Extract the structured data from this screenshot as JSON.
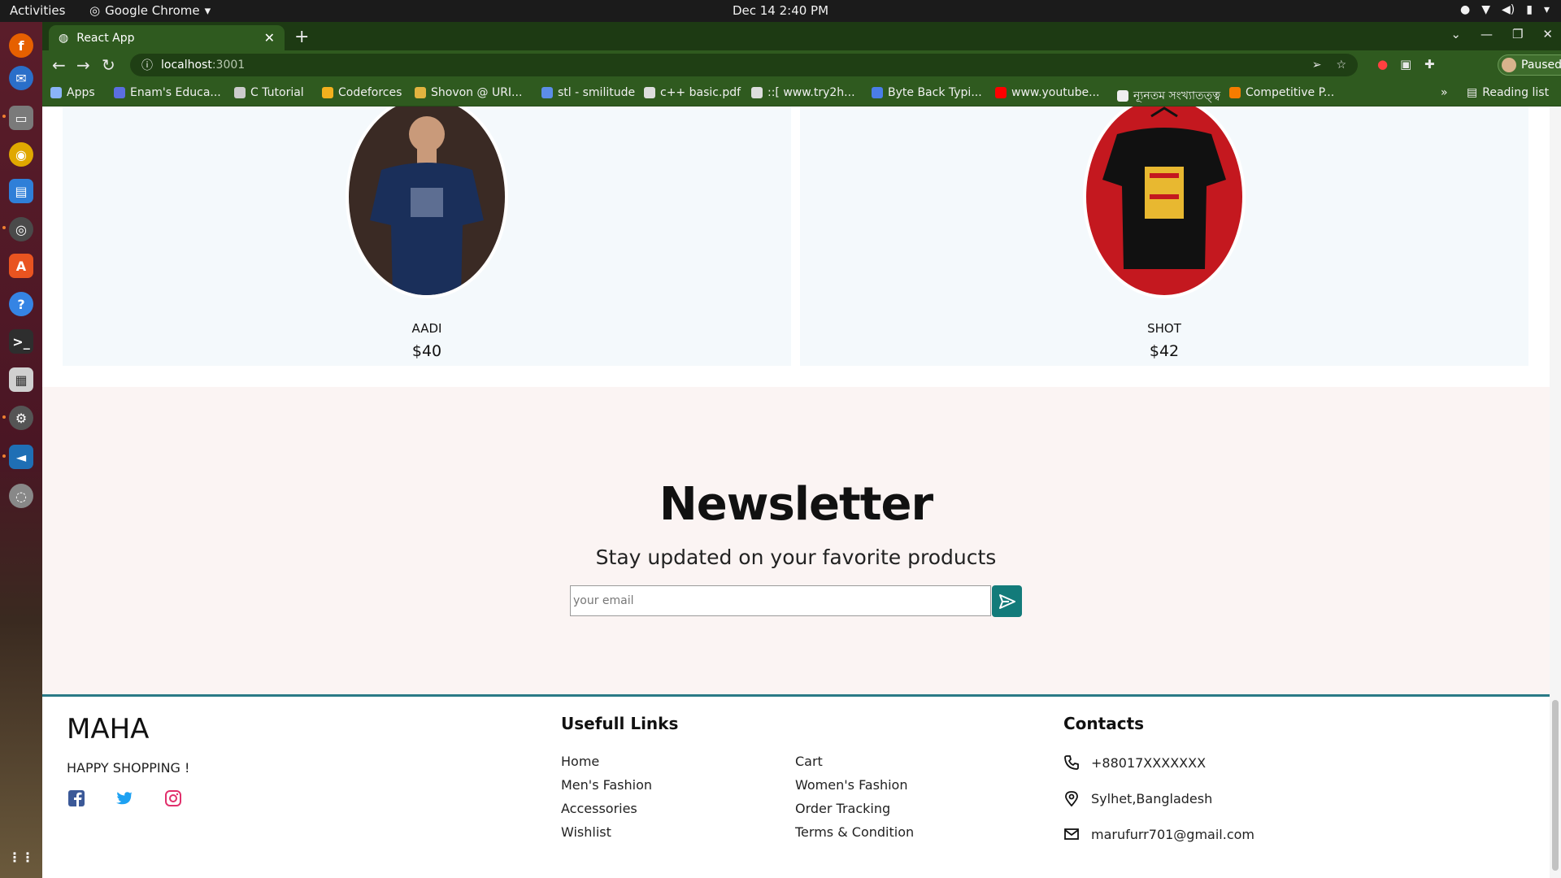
{
  "system": {
    "activities": "Activities",
    "app_name": "Google Chrome",
    "clock": "Dec 14  2:40 PM"
  },
  "browser": {
    "tab_title": "React App",
    "url_host": "localhost",
    "url_port": ":3001",
    "profile_label": "Paused",
    "bookmarks": [
      {
        "label": "Apps",
        "color": "#8ab4f8"
      },
      {
        "label": "Enam's Educa...",
        "color": "#5b6ee1"
      },
      {
        "label": "C Tutorial",
        "color": "#cccccc"
      },
      {
        "label": "Codeforces",
        "color": "#f2b01e"
      },
      {
        "label": "Shovon @ URI...",
        "color": "#e2b340"
      },
      {
        "label": "stl - smilitude",
        "color": "#5c8de8"
      },
      {
        "label": "c++ basic.pdf",
        "color": "#dddddd"
      },
      {
        "label": "::[ www.try2h...",
        "color": "#dddddd"
      },
      {
        "label": "Byte Back Typi...",
        "color": "#4a7de8"
      },
      {
        "label": "www.youtube...",
        "color": "#ff0000"
      },
      {
        "label": "ন্যূনতম সংখ্যাতত্ত্ব",
        "color": "#eeeeee"
      },
      {
        "label": "Competitive P...",
        "color": "#f57c00"
      }
    ],
    "reading_list": "Reading list"
  },
  "products": [
    {
      "name": "AADI",
      "price": "$40",
      "image_bg": "#3a2a24",
      "shirt_color": "#1a2f5a"
    },
    {
      "name": "SHOT",
      "price": "$42",
      "image_bg": "#c4181f",
      "shirt_color": "#111111"
    }
  ],
  "newsletter": {
    "title": "Newsletter",
    "subtitle": "Stay updated on your favorite products",
    "email_placeholder": "your email",
    "accent": "#137b7a"
  },
  "footer": {
    "brand": "MAHA",
    "tagline": "HAPPY SHOPPING !",
    "links_heading": "Usefull Links",
    "links_col1": [
      "Home",
      "Men's Fashion",
      "Accessories",
      "Wishlist"
    ],
    "links_col2": [
      "Cart",
      "Women's Fashion",
      "Order Tracking",
      "Terms & Condition"
    ],
    "contacts_heading": "Contacts",
    "phone": "+88017XXXXXXX",
    "address": "Sylhet,Bangladesh",
    "email": "marufurr701@gmail.com"
  }
}
